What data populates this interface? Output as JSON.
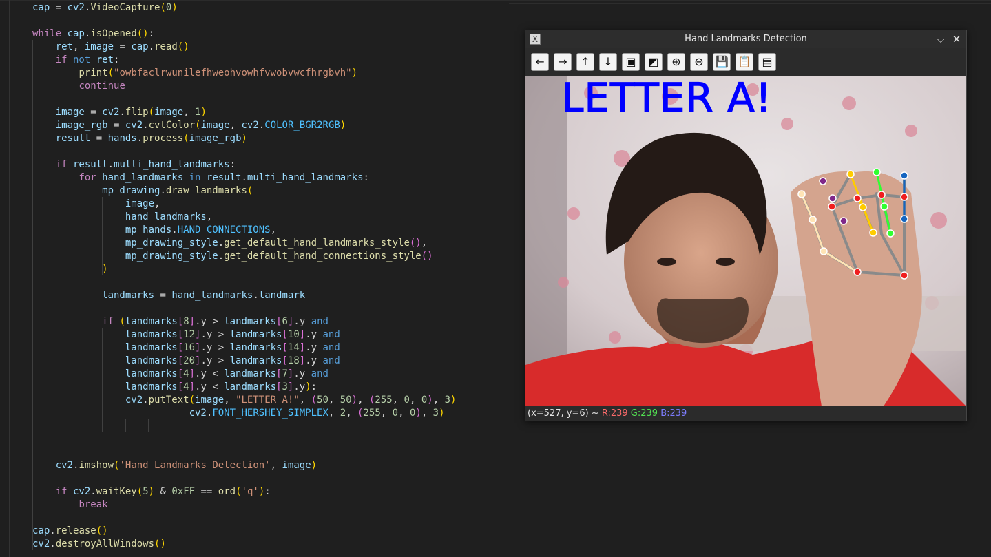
{
  "editor": {
    "lines": [
      [
        {
          "t": "cap",
          "c": "vr"
        },
        {
          "t": " = ",
          "c": "op"
        },
        {
          "t": "cv2",
          "c": "vr"
        },
        {
          "t": ".",
          "c": "op"
        },
        {
          "t": "VideoCapture",
          "c": "fn"
        },
        {
          "t": "(",
          "c": "p1"
        },
        {
          "t": "0",
          "c": "nm"
        },
        {
          "t": ")",
          "c": "p1"
        }
      ],
      [],
      [
        {
          "t": "while",
          "c": "kw"
        },
        {
          "t": " cap",
          "c": "vr"
        },
        {
          "t": ".",
          "c": "op"
        },
        {
          "t": "isOpened",
          "c": "fn"
        },
        {
          "t": "()",
          "c": "p1"
        },
        {
          "t": ":",
          "c": "op"
        }
      ],
      [
        {
          "t": "    ret",
          "c": "vr"
        },
        {
          "t": ", ",
          "c": "op"
        },
        {
          "t": "image",
          "c": "vr"
        },
        {
          "t": " = ",
          "c": "op"
        },
        {
          "t": "cap",
          "c": "vr"
        },
        {
          "t": ".",
          "c": "op"
        },
        {
          "t": "read",
          "c": "fn"
        },
        {
          "t": "()",
          "c": "p1"
        }
      ],
      [
        {
          "t": "    ",
          "c": "op"
        },
        {
          "t": "if",
          "c": "kw"
        },
        {
          "t": " not",
          "c": "kb"
        },
        {
          "t": " ret",
          "c": "vr"
        },
        {
          "t": ":",
          "c": "op"
        }
      ],
      [
        {
          "t": "        ",
          "c": "op"
        },
        {
          "t": "print",
          "c": "fn"
        },
        {
          "t": "(",
          "c": "p1"
        },
        {
          "t": "\"owbfaclrwunilefhweohvowhfvwobvwcfhrgbvh\"",
          "c": "st"
        },
        {
          "t": ")",
          "c": "p1"
        }
      ],
      [
        {
          "t": "        ",
          "c": "op"
        },
        {
          "t": "continue",
          "c": "kw"
        }
      ],
      [],
      [
        {
          "t": "    image",
          "c": "vr"
        },
        {
          "t": " = ",
          "c": "op"
        },
        {
          "t": "cv2",
          "c": "vr"
        },
        {
          "t": ".",
          "c": "op"
        },
        {
          "t": "flip",
          "c": "fn"
        },
        {
          "t": "(",
          "c": "p1"
        },
        {
          "t": "image",
          "c": "vr"
        },
        {
          "t": ", ",
          "c": "op"
        },
        {
          "t": "1",
          "c": "nm"
        },
        {
          "t": ")",
          "c": "p1"
        }
      ],
      [
        {
          "t": "    image_rgb",
          "c": "vr"
        },
        {
          "t": " = ",
          "c": "op"
        },
        {
          "t": "cv2",
          "c": "vr"
        },
        {
          "t": ".",
          "c": "op"
        },
        {
          "t": "cvtColor",
          "c": "fn"
        },
        {
          "t": "(",
          "c": "p1"
        },
        {
          "t": "image",
          "c": "vr"
        },
        {
          "t": ", ",
          "c": "op"
        },
        {
          "t": "cv2",
          "c": "vr"
        },
        {
          "t": ".",
          "c": "op"
        },
        {
          "t": "COLOR_BGR2RGB",
          "c": "cst"
        },
        {
          "t": ")",
          "c": "p1"
        }
      ],
      [
        {
          "t": "    result",
          "c": "vr"
        },
        {
          "t": " = ",
          "c": "op"
        },
        {
          "t": "hands",
          "c": "vr"
        },
        {
          "t": ".",
          "c": "op"
        },
        {
          "t": "process",
          "c": "fn"
        },
        {
          "t": "(",
          "c": "p1"
        },
        {
          "t": "image_rgb",
          "c": "vr"
        },
        {
          "t": ")",
          "c": "p1"
        }
      ],
      [],
      [
        {
          "t": "    ",
          "c": "op"
        },
        {
          "t": "if",
          "c": "kw"
        },
        {
          "t": " result",
          "c": "vr"
        },
        {
          "t": ".",
          "c": "op"
        },
        {
          "t": "multi_hand_landmarks",
          "c": "vr"
        },
        {
          "t": ":",
          "c": "op"
        }
      ],
      [
        {
          "t": "        ",
          "c": "op"
        },
        {
          "t": "for",
          "c": "kw"
        },
        {
          "t": " hand_landmarks",
          "c": "vr"
        },
        {
          "t": " in",
          "c": "kb"
        },
        {
          "t": " result",
          "c": "vr"
        },
        {
          "t": ".",
          "c": "op"
        },
        {
          "t": "multi_hand_landmarks",
          "c": "vr"
        },
        {
          "t": ":",
          "c": "op"
        }
      ],
      [
        {
          "t": "            mp_drawing",
          "c": "vr"
        },
        {
          "t": ".",
          "c": "op"
        },
        {
          "t": "draw_landmarks",
          "c": "fn"
        },
        {
          "t": "(",
          "c": "p1"
        }
      ],
      [
        {
          "t": "                image",
          "c": "vr"
        },
        {
          "t": ",",
          "c": "op"
        }
      ],
      [
        {
          "t": "                hand_landmarks",
          "c": "vr"
        },
        {
          "t": ",",
          "c": "op"
        }
      ],
      [
        {
          "t": "                mp_hands",
          "c": "vr"
        },
        {
          "t": ".",
          "c": "op"
        },
        {
          "t": "HAND_CONNECTIONS",
          "c": "cst"
        },
        {
          "t": ",",
          "c": "op"
        }
      ],
      [
        {
          "t": "                mp_drawing_style",
          "c": "vr"
        },
        {
          "t": ".",
          "c": "op"
        },
        {
          "t": "get_default_hand_landmarks_style",
          "c": "fn"
        },
        {
          "t": "()",
          "c": "p2"
        },
        {
          "t": ",",
          "c": "op"
        }
      ],
      [
        {
          "t": "                mp_drawing_style",
          "c": "vr"
        },
        {
          "t": ".",
          "c": "op"
        },
        {
          "t": "get_default_hand_connections_style",
          "c": "fn"
        },
        {
          "t": "()",
          "c": "p2"
        }
      ],
      [
        {
          "t": "            ",
          "c": "op"
        },
        {
          "t": ")",
          "c": "p1"
        }
      ],
      [],
      [
        {
          "t": "            landmarks",
          "c": "vr"
        },
        {
          "t": " = ",
          "c": "op"
        },
        {
          "t": "hand_landmarks",
          "c": "vr"
        },
        {
          "t": ".",
          "c": "op"
        },
        {
          "t": "landmark",
          "c": "vr"
        }
      ],
      [],
      [
        {
          "t": "            ",
          "c": "op"
        },
        {
          "t": "if",
          "c": "kw"
        },
        {
          "t": " ",
          "c": "op"
        },
        {
          "t": "(",
          "c": "p1"
        },
        {
          "t": "landmarks",
          "c": "vr"
        },
        {
          "t": "[",
          "c": "p2"
        },
        {
          "t": "8",
          "c": "nm"
        },
        {
          "t": "]",
          "c": "p2"
        },
        {
          "t": ".y > ",
          "c": "op"
        },
        {
          "t": "landmarks",
          "c": "vr"
        },
        {
          "t": "[",
          "c": "p2"
        },
        {
          "t": "6",
          "c": "nm"
        },
        {
          "t": "]",
          "c": "p2"
        },
        {
          "t": ".y ",
          "c": "op"
        },
        {
          "t": "and",
          "c": "kb"
        }
      ],
      [
        {
          "t": "                landmarks",
          "c": "vr"
        },
        {
          "t": "[",
          "c": "p2"
        },
        {
          "t": "12",
          "c": "nm"
        },
        {
          "t": "]",
          "c": "p2"
        },
        {
          "t": ".y > ",
          "c": "op"
        },
        {
          "t": "landmarks",
          "c": "vr"
        },
        {
          "t": "[",
          "c": "p2"
        },
        {
          "t": "10",
          "c": "nm"
        },
        {
          "t": "]",
          "c": "p2"
        },
        {
          "t": ".y ",
          "c": "op"
        },
        {
          "t": "and",
          "c": "kb"
        }
      ],
      [
        {
          "t": "                landmarks",
          "c": "vr"
        },
        {
          "t": "[",
          "c": "p2"
        },
        {
          "t": "16",
          "c": "nm"
        },
        {
          "t": "]",
          "c": "p2"
        },
        {
          "t": ".y > ",
          "c": "op"
        },
        {
          "t": "landmarks",
          "c": "vr"
        },
        {
          "t": "[",
          "c": "p2"
        },
        {
          "t": "14",
          "c": "nm"
        },
        {
          "t": "]",
          "c": "p2"
        },
        {
          "t": ".y ",
          "c": "op"
        },
        {
          "t": "and",
          "c": "kb"
        }
      ],
      [
        {
          "t": "                landmarks",
          "c": "vr"
        },
        {
          "t": "[",
          "c": "p2"
        },
        {
          "t": "20",
          "c": "nm"
        },
        {
          "t": "]",
          "c": "p2"
        },
        {
          "t": ".y > ",
          "c": "op"
        },
        {
          "t": "landmarks",
          "c": "vr"
        },
        {
          "t": "[",
          "c": "p2"
        },
        {
          "t": "18",
          "c": "nm"
        },
        {
          "t": "]",
          "c": "p2"
        },
        {
          "t": ".y ",
          "c": "op"
        },
        {
          "t": "and",
          "c": "kb"
        }
      ],
      [
        {
          "t": "                landmarks",
          "c": "vr"
        },
        {
          "t": "[",
          "c": "p2"
        },
        {
          "t": "4",
          "c": "nm"
        },
        {
          "t": "]",
          "c": "p2"
        },
        {
          "t": ".y < ",
          "c": "op"
        },
        {
          "t": "landmarks",
          "c": "vr"
        },
        {
          "t": "[",
          "c": "p2"
        },
        {
          "t": "7",
          "c": "nm"
        },
        {
          "t": "]",
          "c": "p2"
        },
        {
          "t": ".y ",
          "c": "op"
        },
        {
          "t": "and",
          "c": "kb"
        }
      ],
      [
        {
          "t": "                landmarks",
          "c": "vr"
        },
        {
          "t": "[",
          "c": "p2"
        },
        {
          "t": "4",
          "c": "nm"
        },
        {
          "t": "]",
          "c": "p2"
        },
        {
          "t": ".y < ",
          "c": "op"
        },
        {
          "t": "landmarks",
          "c": "vr"
        },
        {
          "t": "[",
          "c": "p2"
        },
        {
          "t": "3",
          "c": "nm"
        },
        {
          "t": "]",
          "c": "p2"
        },
        {
          "t": ".y",
          "c": "op"
        },
        {
          "t": ")",
          "c": "p1"
        },
        {
          "t": ":",
          "c": "op"
        }
      ],
      [
        {
          "t": "                cv2",
          "c": "vr"
        },
        {
          "t": ".",
          "c": "op"
        },
        {
          "t": "putText",
          "c": "fn"
        },
        {
          "t": "(",
          "c": "p1"
        },
        {
          "t": "image",
          "c": "vr"
        },
        {
          "t": ", ",
          "c": "op"
        },
        {
          "t": "\"LETTER A!\"",
          "c": "st"
        },
        {
          "t": ", ",
          "c": "op"
        },
        {
          "t": "(",
          "c": "p2"
        },
        {
          "t": "50",
          "c": "nm"
        },
        {
          "t": ", ",
          "c": "op"
        },
        {
          "t": "50",
          "c": "nm"
        },
        {
          "t": ")",
          "c": "p2"
        },
        {
          "t": ", ",
          "c": "op"
        },
        {
          "t": "(",
          "c": "p2"
        },
        {
          "t": "255",
          "c": "nm"
        },
        {
          "t": ", ",
          "c": "op"
        },
        {
          "t": "0",
          "c": "nm"
        },
        {
          "t": ", ",
          "c": "op"
        },
        {
          "t": "0",
          "c": "nm"
        },
        {
          "t": ")",
          "c": "p2"
        },
        {
          "t": ", ",
          "c": "op"
        },
        {
          "t": "3",
          "c": "nm"
        },
        {
          "t": ")",
          "c": "p1"
        }
      ],
      [
        {
          "t": "                           cv2",
          "c": "vr"
        },
        {
          "t": ".",
          "c": "op"
        },
        {
          "t": "FONT_HERSHEY_SIMPLEX",
          "c": "cst"
        },
        {
          "t": ", ",
          "c": "op"
        },
        {
          "t": "2",
          "c": "nm"
        },
        {
          "t": ", ",
          "c": "op"
        },
        {
          "t": "(",
          "c": "p2"
        },
        {
          "t": "255",
          "c": "nm"
        },
        {
          "t": ", ",
          "c": "op"
        },
        {
          "t": "0",
          "c": "nm"
        },
        {
          "t": ", ",
          "c": "op"
        },
        {
          "t": "0",
          "c": "nm"
        },
        {
          "t": ")",
          "c": "p2"
        },
        {
          "t": ", ",
          "c": "op"
        },
        {
          "t": "3",
          "c": "nm"
        },
        {
          "t": ")",
          "c": "p1"
        }
      ],
      [],
      [],
      [],
      [
        {
          "t": "    cv2",
          "c": "vr"
        },
        {
          "t": ".",
          "c": "op"
        },
        {
          "t": "imshow",
          "c": "fn"
        },
        {
          "t": "(",
          "c": "p1"
        },
        {
          "t": "'Hand Landmarks Detection'",
          "c": "st"
        },
        {
          "t": ", ",
          "c": "op"
        },
        {
          "t": "image",
          "c": "vr"
        },
        {
          "t": ")",
          "c": "p1"
        }
      ],
      [],
      [
        {
          "t": "    ",
          "c": "op"
        },
        {
          "t": "if",
          "c": "kw"
        },
        {
          "t": " cv2",
          "c": "vr"
        },
        {
          "t": ".",
          "c": "op"
        },
        {
          "t": "waitKey",
          "c": "fn"
        },
        {
          "t": "(",
          "c": "p1"
        },
        {
          "t": "5",
          "c": "nm"
        },
        {
          "t": ")",
          "c": "p1"
        },
        {
          "t": " & ",
          "c": "op"
        },
        {
          "t": "0xFF",
          "c": "nm"
        },
        {
          "t": " == ",
          "c": "op"
        },
        {
          "t": "ord",
          "c": "fn"
        },
        {
          "t": "(",
          "c": "p1"
        },
        {
          "t": "'q'",
          "c": "st"
        },
        {
          "t": ")",
          "c": "p1"
        },
        {
          "t": ":",
          "c": "op"
        }
      ],
      [
        {
          "t": "        ",
          "c": "op"
        },
        {
          "t": "break",
          "c": "kw"
        }
      ],
      [],
      [
        {
          "t": "cap",
          "c": "vr"
        },
        {
          "t": ".",
          "c": "op"
        },
        {
          "t": "release",
          "c": "fn"
        },
        {
          "t": "()",
          "c": "p1"
        }
      ],
      [
        {
          "t": "cv2",
          "c": "vr"
        },
        {
          "t": ".",
          "c": "op"
        },
        {
          "t": "destroyAllWindows",
          "c": "fn"
        },
        {
          "t": "()",
          "c": "p1"
        }
      ]
    ]
  },
  "cv_window": {
    "title": "Hand Landmarks Detection",
    "app_icon": "X",
    "controls": {
      "minimize_icon": "chevron-down-icon",
      "close_icon": "close-icon",
      "minimize_glyph": "⌵",
      "close_glyph": "✕"
    },
    "toolbar": [
      {
        "name": "pan-left-button",
        "glyph": "←"
      },
      {
        "name": "pan-right-button",
        "glyph": "→"
      },
      {
        "name": "pan-up-button",
        "glyph": "↑"
      },
      {
        "name": "pan-down-button",
        "glyph": "↓"
      },
      {
        "name": "zoom-x1-button",
        "glyph": "▣"
      },
      {
        "name": "zoom-fit-button",
        "glyph": "◩"
      },
      {
        "name": "zoom-in-button",
        "glyph": "⊕"
      },
      {
        "name": "zoom-out-button",
        "glyph": "⊖"
      },
      {
        "name": "save-image-button",
        "glyph": "💾"
      },
      {
        "name": "copy-clipboard-button",
        "glyph": "📋"
      },
      {
        "name": "properties-button",
        "glyph": "▤"
      }
    ],
    "overlay_text": "LETTER A!",
    "overlay_color": "#0000ff",
    "status": {
      "coords": "(x=527, y=6) ~ ",
      "r": "R:239",
      "g": "G:239",
      "b": "B:239"
    }
  }
}
